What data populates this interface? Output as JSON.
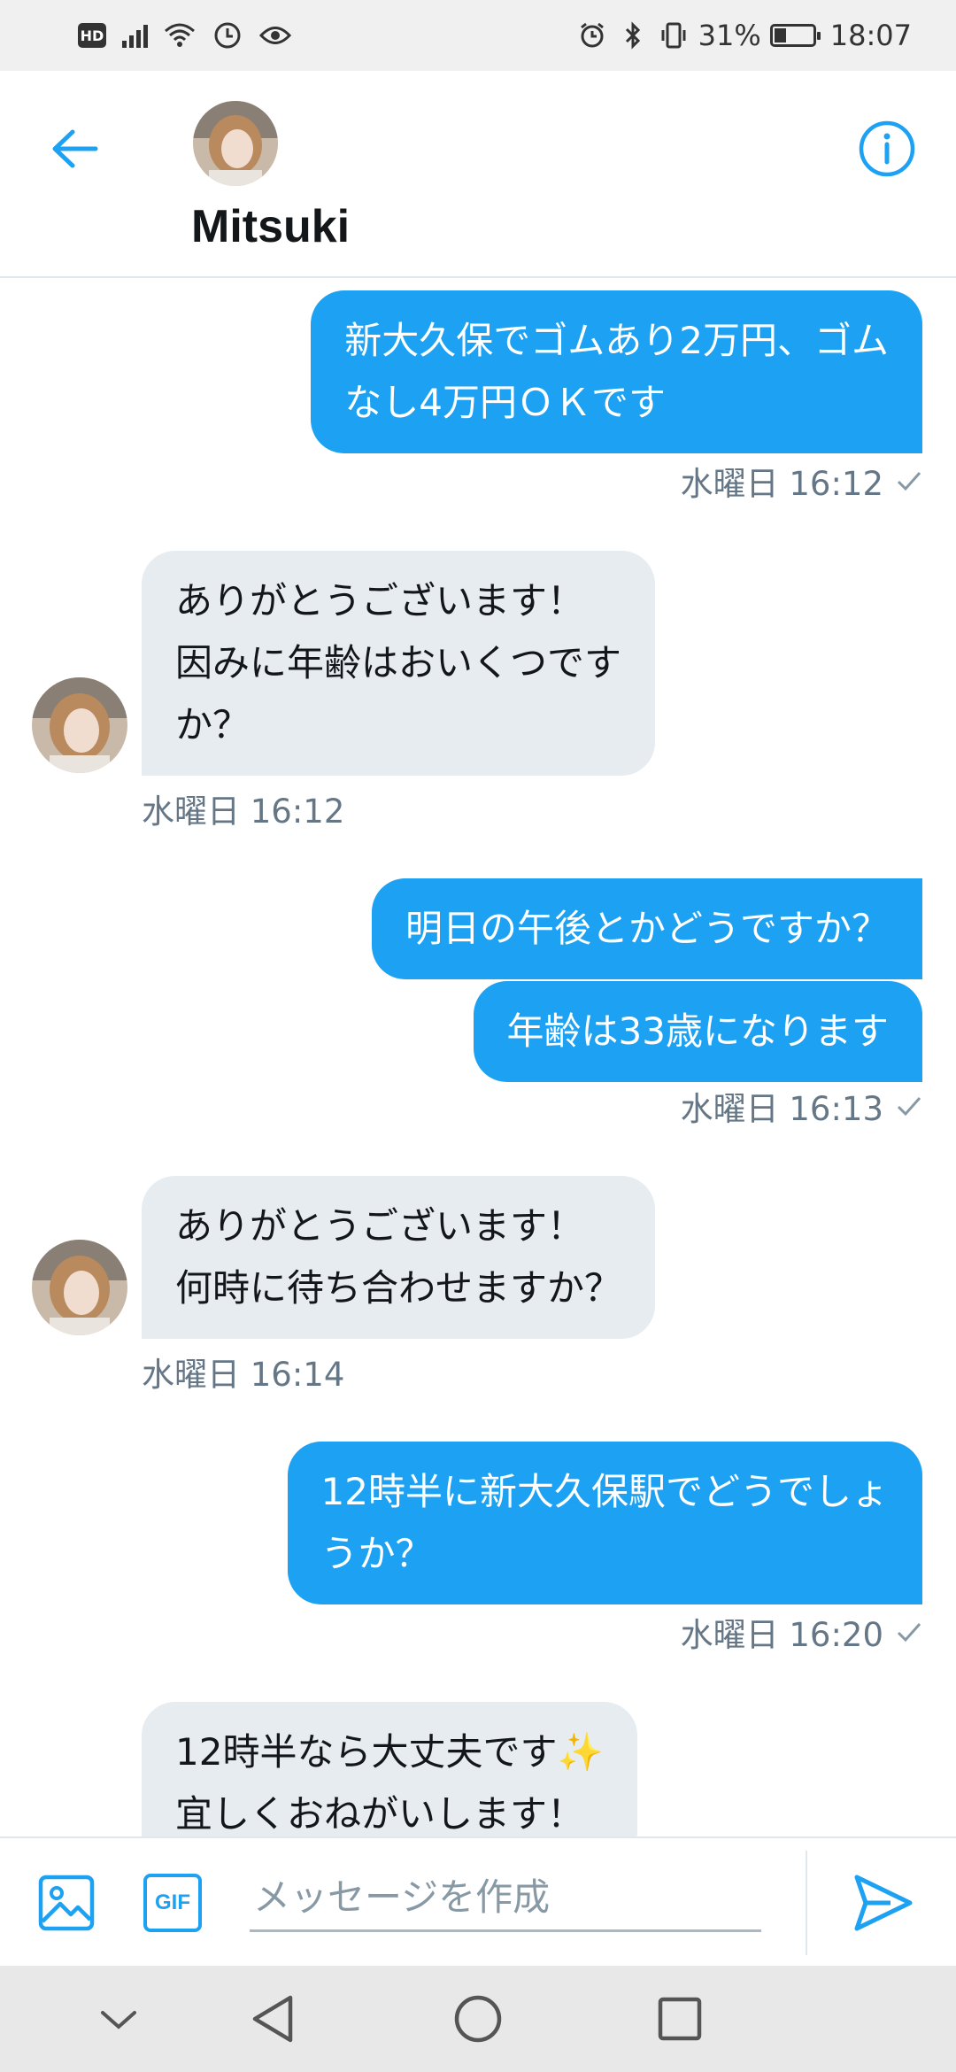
{
  "status_bar": {
    "hd_badge": "HD",
    "battery_text": "31%",
    "battery_level": 0.31,
    "time": "18:07",
    "icons": [
      "signal-icon",
      "wifi-icon",
      "data-saver-icon",
      "eye-icon",
      "alarm-icon",
      "bluetooth-icon",
      "vibrate-icon",
      "battery-icon"
    ]
  },
  "header": {
    "name": "Mitsuki",
    "accent_color": "#1da1f2"
  },
  "messages": [
    {
      "direction": "out",
      "text": "新大久保でゴムあり2万円、ゴム\nなし4万円ＯＫです",
      "time": "水曜日 16:12",
      "read": true
    },
    {
      "direction": "in",
      "text": "ありがとうございます！\n因みに年齢はおいくつです\nか？",
      "time": "水曜日 16:12"
    },
    {
      "direction": "out",
      "text": "明日の午後とかどうですか？"
    },
    {
      "direction": "out",
      "text": "年齢は33歳になります",
      "time": "水曜日 16:13",
      "read": true
    },
    {
      "direction": "in",
      "text": "ありがとうございます！\n何時に待ち合わせますか？",
      "time": "水曜日 16:14"
    },
    {
      "direction": "out",
      "text": "12時半に新大久保駅でどうでしょ\nうか？",
      "time": "水曜日 16:20",
      "read": true
    },
    {
      "direction": "in",
      "text": "12時半なら大丈夫です✨\n宜しくおねがいします！"
    }
  ],
  "composer": {
    "gif_label": "GIF",
    "placeholder": "メッセージを作成"
  },
  "colors": {
    "outgoing_bubble": "#1da1f2",
    "incoming_bubble": "#e6ecf0",
    "meta_text": "#657786"
  }
}
